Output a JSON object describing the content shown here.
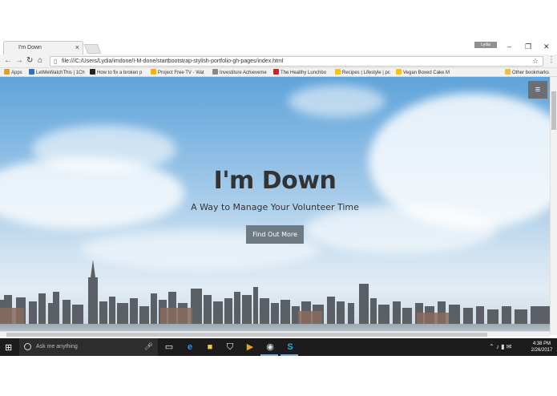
{
  "browser": {
    "tab_title": "I'm Down",
    "tab_close": "×",
    "user_chip": "Lydia",
    "url": "file:///C:/Users/Lydia/imdone/I-M-done/startbootstrap-stylish-portfolio-gh-pages/index.html",
    "window_controls": {
      "minimize": "–",
      "restore": "❐",
      "close": "✕"
    }
  },
  "nav_icons": {
    "back": "←",
    "forward": "→",
    "reload": "↻",
    "home": "⌂",
    "star": "☆",
    "menu": "⋮"
  },
  "bookmarks": [
    {
      "label": "Apps",
      "color": "#e5a125"
    },
    {
      "label": "LetMeWatchThis | 1Ch",
      "color": "#3b6db3"
    },
    {
      "label": "How to fix a broken p",
      "color": "#222222"
    },
    {
      "label": "Project Free TV - Wat",
      "color": "#f2b01e"
    },
    {
      "label": "Investiture Achieveme",
      "color": "#888888"
    },
    {
      "label": "The Healthy Lunchbo",
      "color": "#cc2222"
    },
    {
      "label": "Recipes | Lifestyle | pc",
      "color": "#f2c21e"
    },
    {
      "label": "Vegan Boxed Cake M",
      "color": "#f2c21e"
    },
    {
      "label": "Other bookmarks",
      "color": "#e5c055"
    }
  ],
  "hero": {
    "title": "I'm Down",
    "subtitle": "A Way to Manage Your Volunteer Time",
    "cta_label": "Find Out More",
    "menu_icon": "≡"
  },
  "taskbar": {
    "search_placeholder": "Ask me anything",
    "time": "4:38 PM",
    "date": "2/26/2017",
    "tray_glyphs": "⌃ ♪ ▮ ✉"
  }
}
